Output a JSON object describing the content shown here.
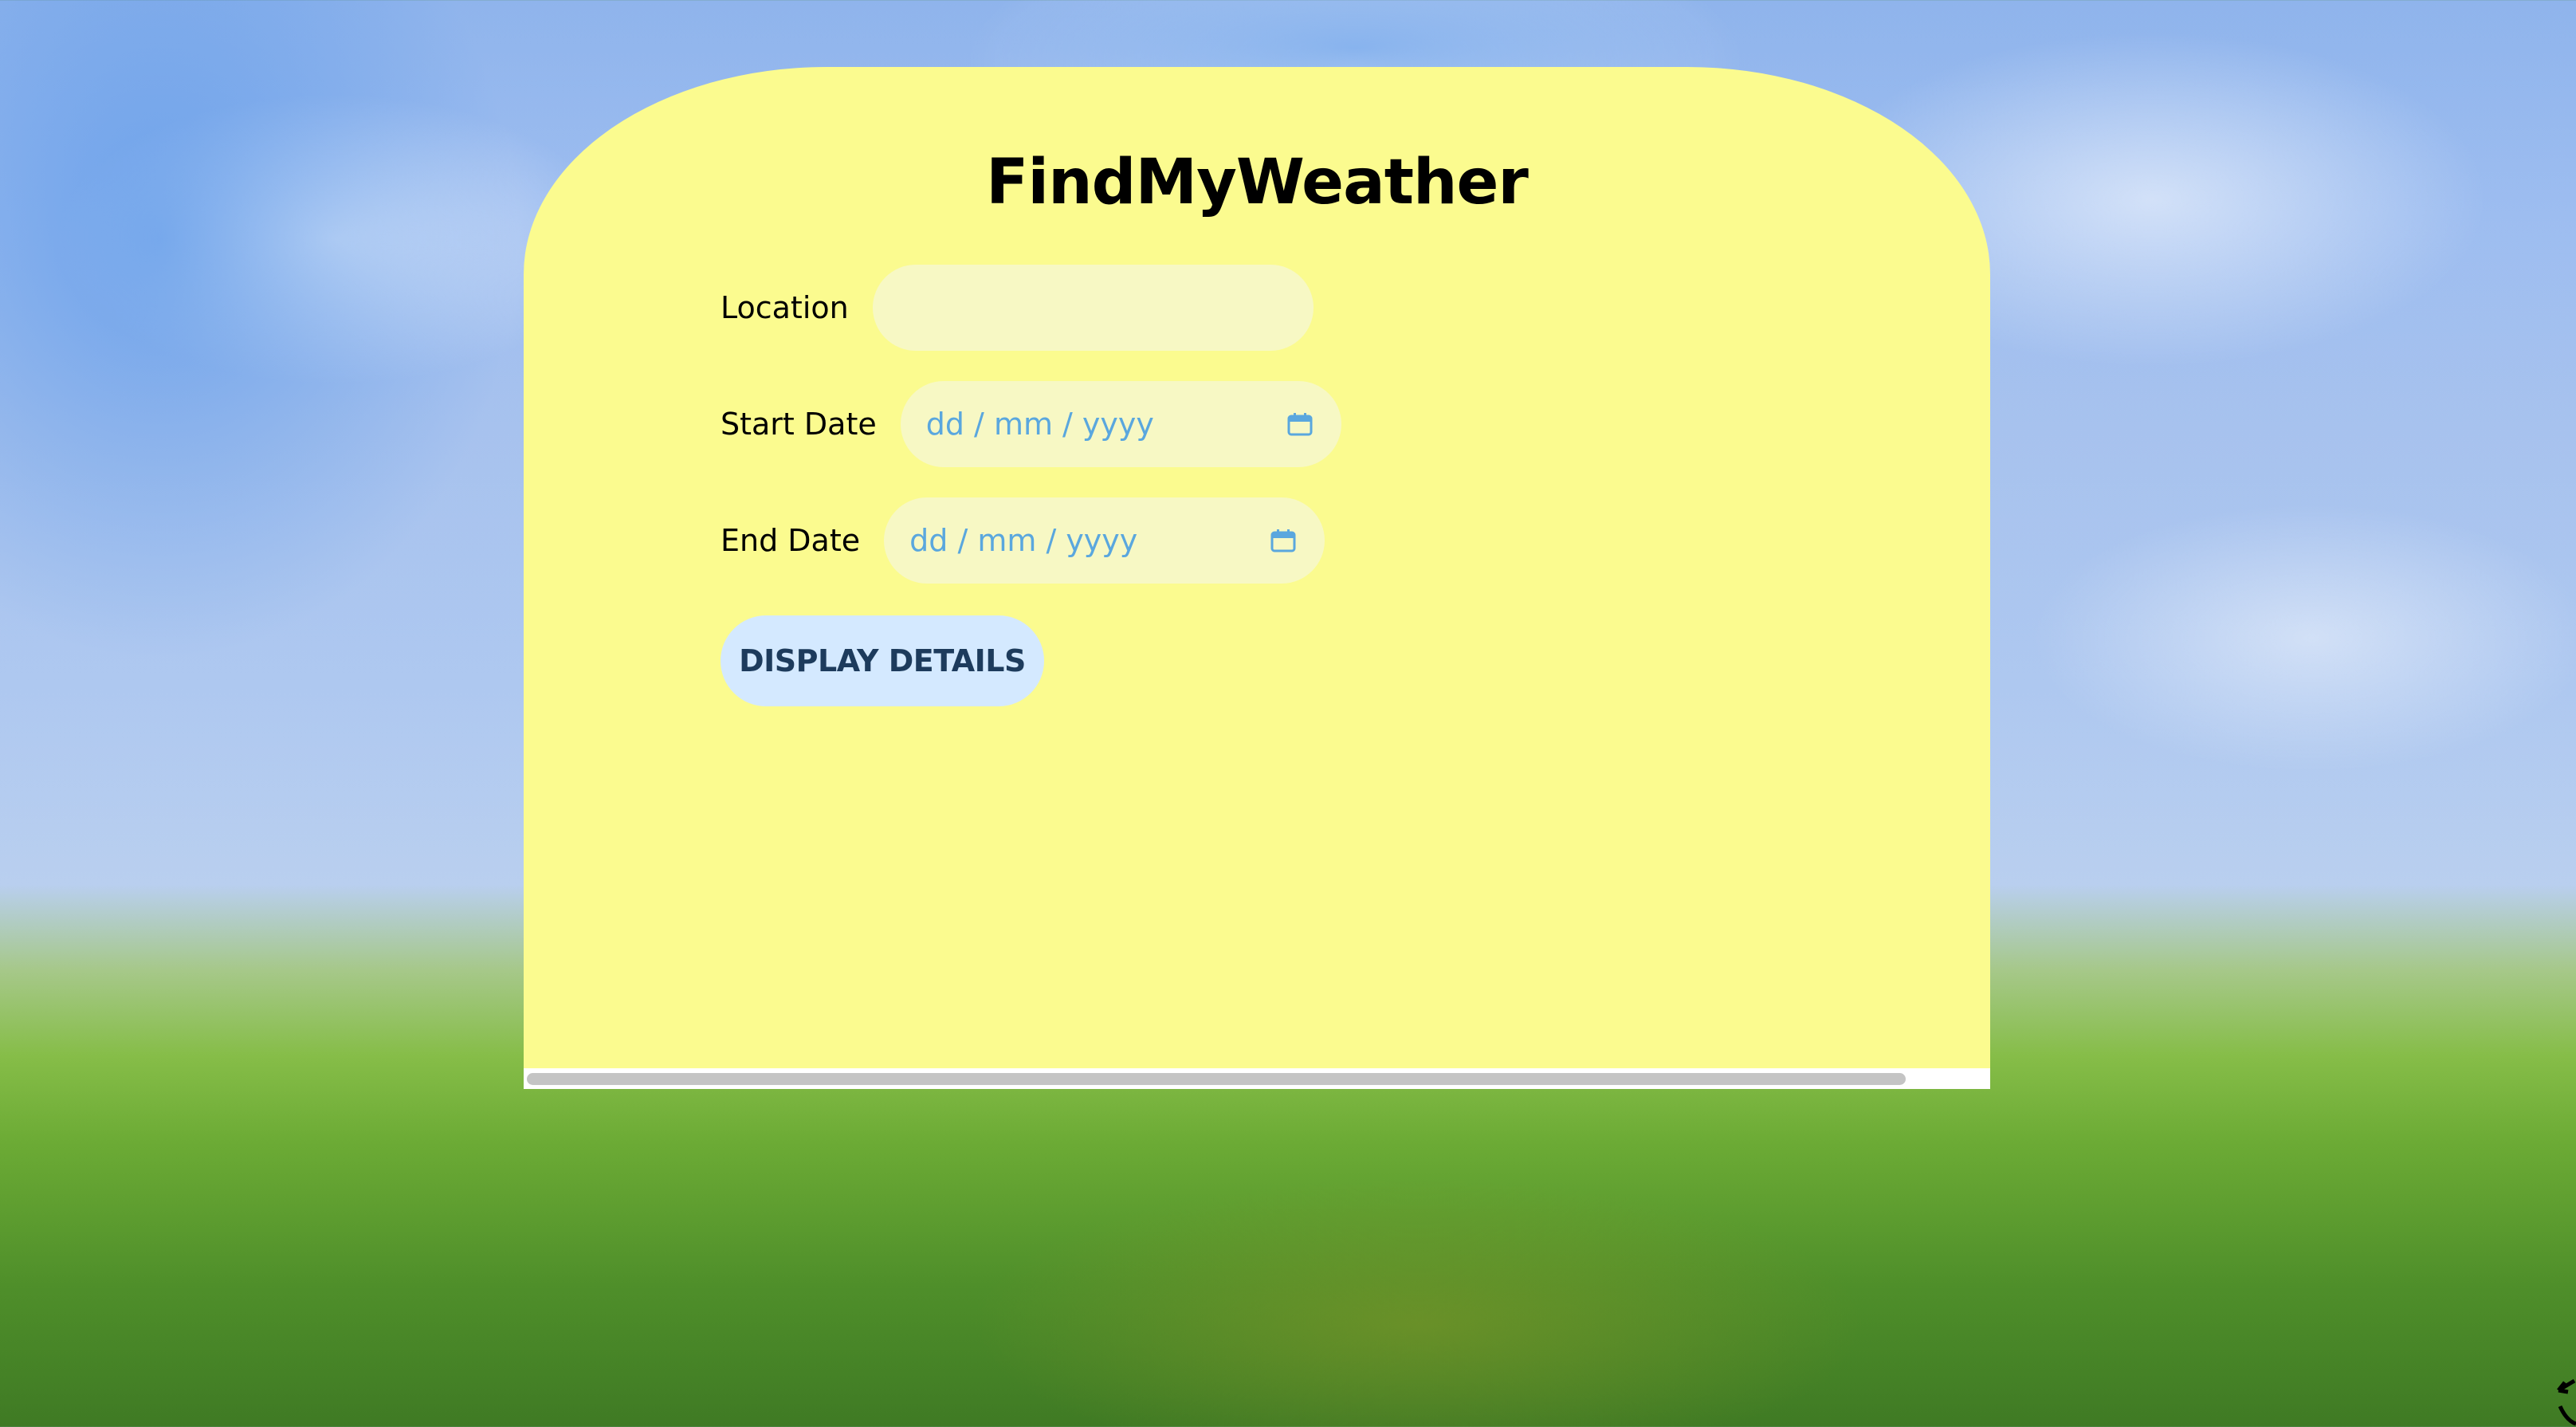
{
  "app": {
    "title": "FindMyWeather"
  },
  "form": {
    "location": {
      "label": "Location",
      "value": "",
      "placeholder": ""
    },
    "start_date": {
      "label": "Start Date",
      "placeholder": "dd / mm / yyyy",
      "icon": "calendar-icon"
    },
    "end_date": {
      "label": "End Date",
      "placeholder": "dd / mm / yyyy",
      "icon": "calendar-icon"
    },
    "submit_label": "DISPLAY DETAILS"
  },
  "colors": {
    "card": "#fbfb8f",
    "field": "#f7f8c4",
    "date_text": "#5aa7de",
    "button_bg": "#d4e9ff",
    "button_text": "#1d3b5c"
  }
}
